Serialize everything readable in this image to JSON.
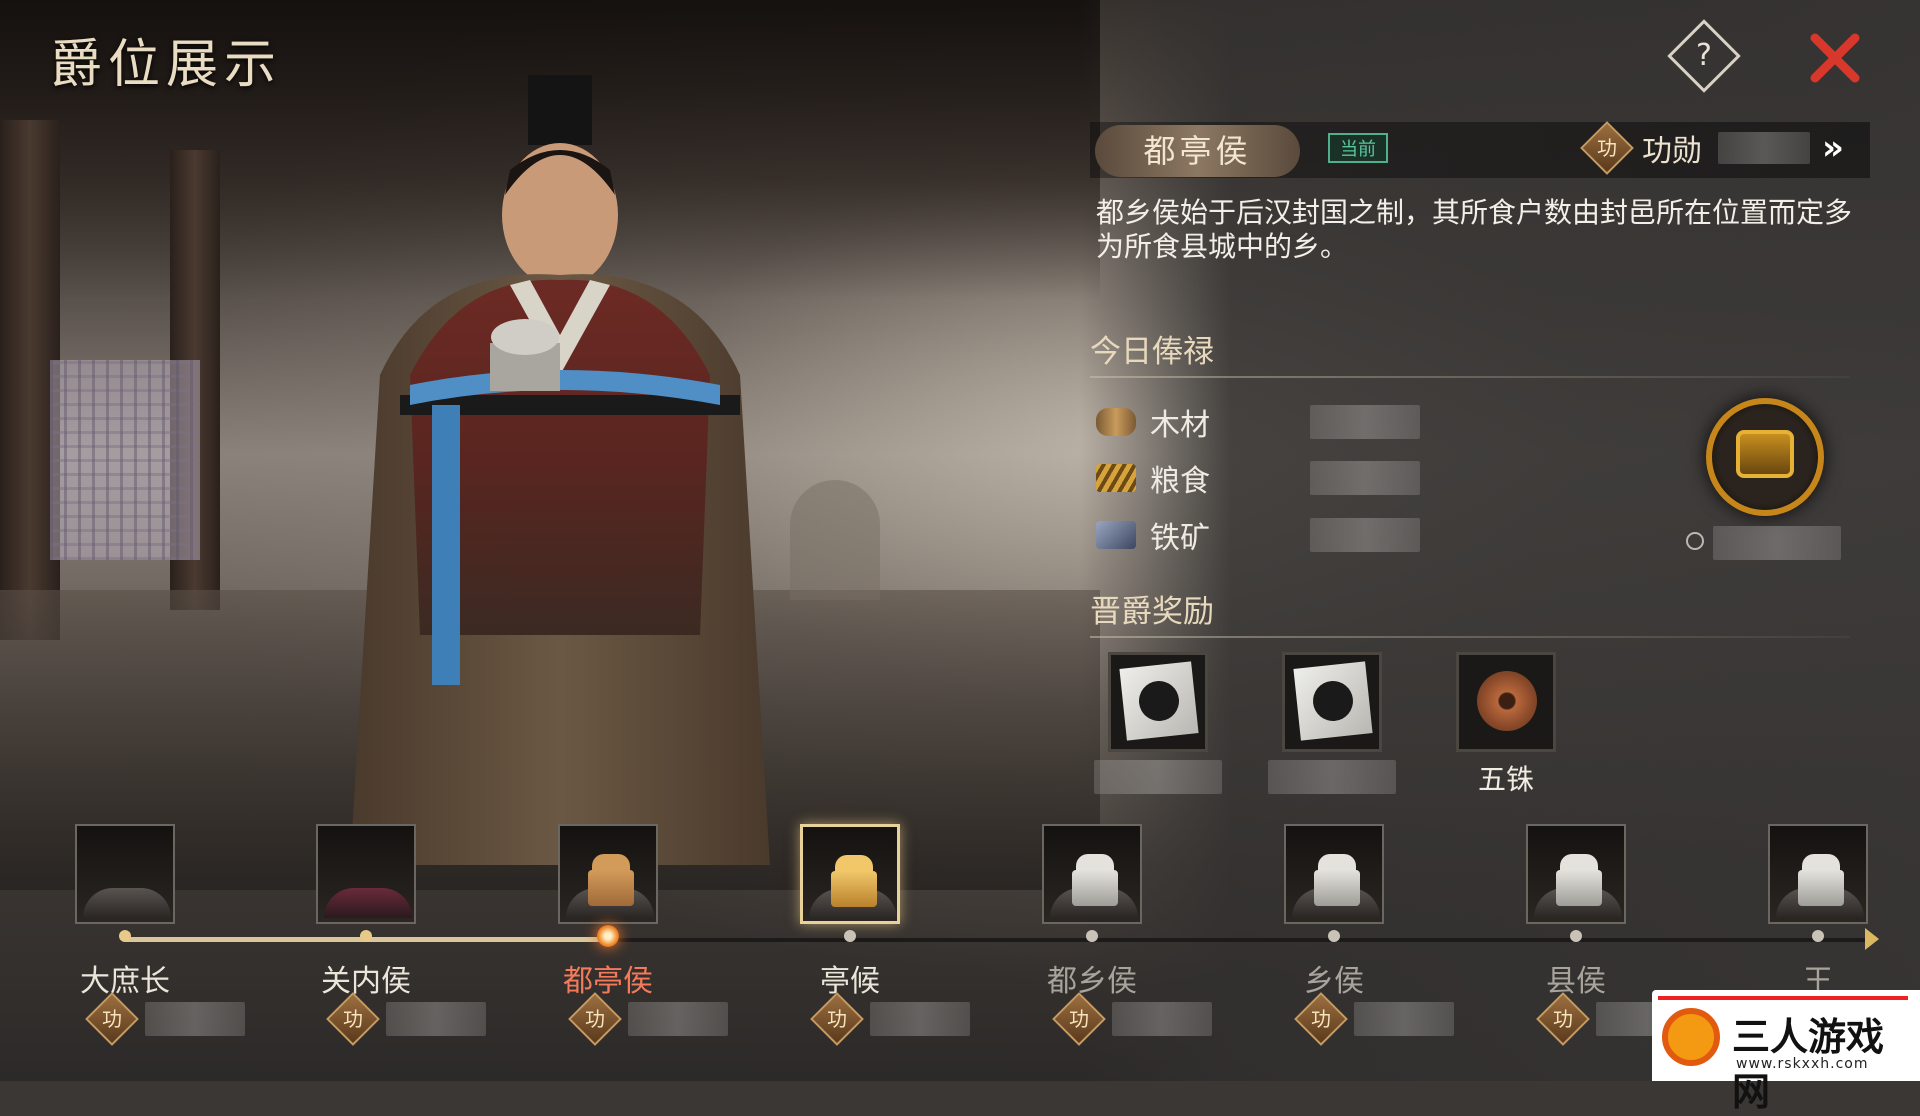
{
  "title": "爵位展示",
  "help_label": "?",
  "current_rank": {
    "name": "都亭侯",
    "badge": "当前",
    "merit_label": "功勋",
    "merit_icon_text": "功",
    "more": "»"
  },
  "description": "都乡侯始于后汉封国之制，其所食户数由封邑所在位置而定多为所食县城中的乡。",
  "salary": {
    "title": "今日俸禄",
    "items": [
      {
        "icon": "wood-icon",
        "label": "木材"
      },
      {
        "icon": "grain-icon",
        "label": "粮食"
      },
      {
        "icon": "iron-ore-icon",
        "label": "铁矿"
      }
    ],
    "chest_icon": "treasure-chest-icon",
    "timer_icon": "clock-icon"
  },
  "rewards": {
    "title": "晋爵奖励",
    "items": [
      {
        "icon": "portrait-card-icon",
        "label": ""
      },
      {
        "icon": "portrait-card-icon",
        "label": ""
      },
      {
        "icon": "wuzhu-coin-icon",
        "label": "五铢"
      }
    ]
  },
  "ranks": [
    {
      "name": "大庶长",
      "state": "done",
      "seal": "none"
    },
    {
      "name": "关内侯",
      "state": "done",
      "seal": "none"
    },
    {
      "name": "都亭侯",
      "state": "current",
      "seal": "bronze"
    },
    {
      "name": "亭候",
      "state": "selected",
      "seal": "gold"
    },
    {
      "name": "都乡侯",
      "state": "locked",
      "seal": "silver"
    },
    {
      "name": "乡侯",
      "state": "locked",
      "seal": "silver"
    },
    {
      "name": "县侯",
      "state": "locked",
      "seal": "silver"
    },
    {
      "name": "王",
      "state": "locked",
      "seal": "silver"
    }
  ],
  "merit_icon_text": "功",
  "watermark": {
    "text": "三人游戏网",
    "url": "www.rskxxh.com"
  },
  "colors": {
    "accent_gold": "#e9d29a",
    "current_red": "#f47a5a",
    "badge_green": "#5cc79b",
    "chest_orange": "#c7861a"
  }
}
